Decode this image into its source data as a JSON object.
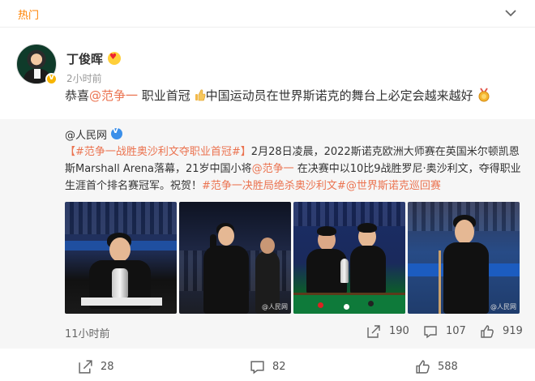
{
  "top": {
    "tag": "热门",
    "chevron_icon": "chevron-down-icon"
  },
  "author": {
    "name": "丁俊晖",
    "time": "2小时前",
    "verified_color": "#f7b500"
  },
  "post": {
    "prefix": "恭喜",
    "mention": "@范争一",
    "middle": " 职业首冠",
    "after_thumb": "中国运动员在世界斯诺克的舞台上必定会越来越好"
  },
  "repost": {
    "author": "@人民网",
    "verified_color": "#3b8fe9",
    "text": {
      "tag1": "【#范争一战胜奥沙利文夺职业首冠#】",
      "t1": "2月28日凌晨，2022斯诺克欧洲大师赛在英国米尔顿凯恩斯Marshall Arena落幕，21岁中国小将",
      "mention": "@范争一",
      "t2": " 在决赛中以10比9战胜罗尼·奥沙利文，夺得职业生涯首个排名赛冠军。祝贺！",
      "tag2": "#范争一决胜局绝杀奥沙利文#",
      "tag3": "@世界斯诺克巡回赛"
    },
    "pics": [
      {
        "label": "trophy-photo"
      },
      {
        "label": "celebration-photo",
        "watermark": "@人民网"
      },
      {
        "label": "final-players-photo"
      },
      {
        "label": "player-portrait-photo",
        "watermark": "@人民网"
      }
    ],
    "time": "11小时前",
    "stats": {
      "share": "190",
      "comment": "107",
      "like": "919"
    }
  },
  "bottom": {
    "share": "28",
    "comment": "82",
    "like": "588"
  },
  "colors": {
    "accent": "#eb7350",
    "tag": "#ff8200"
  }
}
